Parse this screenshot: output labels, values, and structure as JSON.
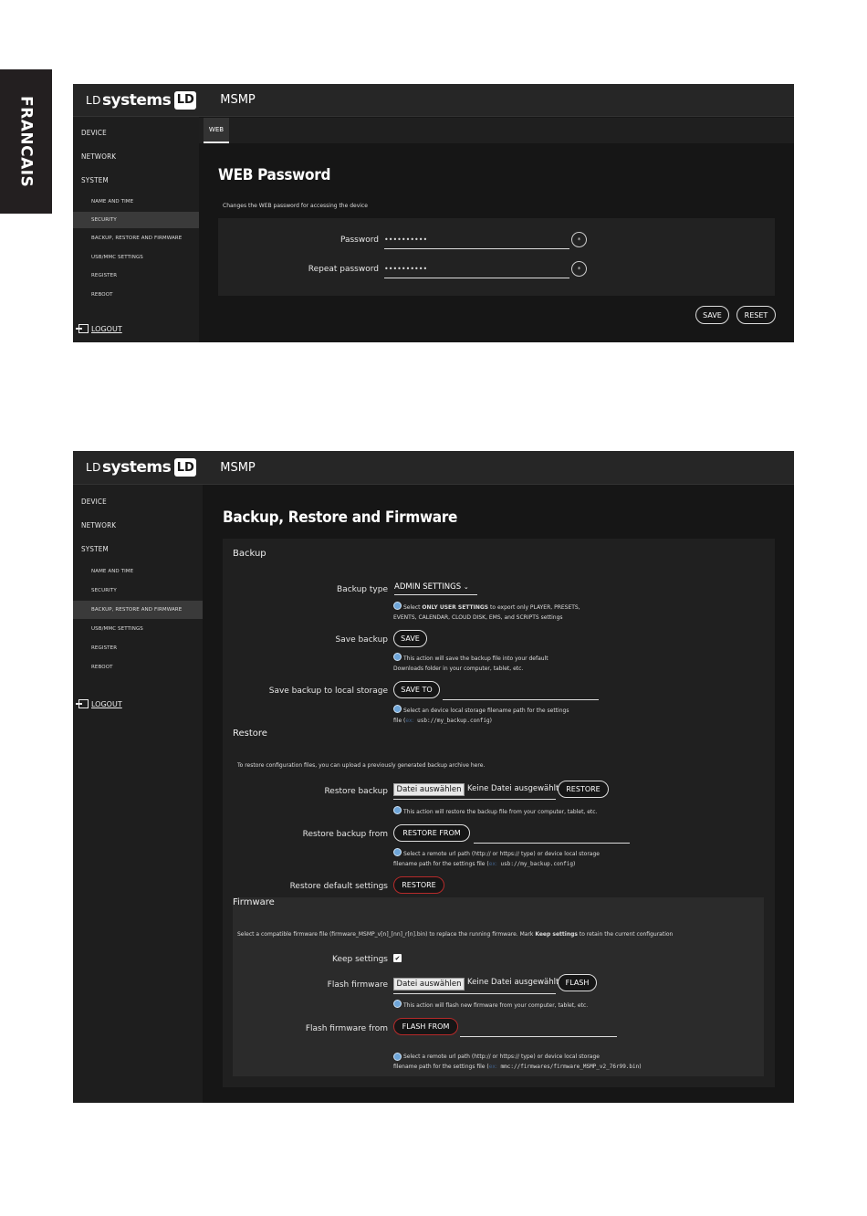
{
  "side_tab": "FRANCAIS",
  "shot1": {
    "logo_ld": "LD",
    "logo_systems": "systems",
    "logo_box": "LD",
    "app_title": "MSMP",
    "nav": {
      "device": "DEVICE",
      "network": "NETWORK",
      "system": "SYSTEM"
    },
    "subnav": [
      "NAME AND TIME",
      "SECURITY",
      "BACKUP, RESTORE AND FIRMWARE",
      "USB/MMC SETTINGS",
      "REGISTER",
      "REBOOT"
    ],
    "logout": "LOGOUT",
    "tab": "WEB",
    "heading": "WEB Password",
    "description": "Changes the WEB password for accessing the device",
    "password_label": "Password",
    "password_value": "••••••••••",
    "repeat_label": "Repeat password",
    "repeat_value": "••••••••••",
    "eye_icon": "*",
    "save": "SAVE",
    "reset": "RESET"
  },
  "shot2": {
    "logo_ld": "LD",
    "logo_systems": "systems",
    "logo_box": "LD",
    "app_title": "MSMP",
    "nav": {
      "device": "DEVICE",
      "network": "NETWORK",
      "system": "SYSTEM"
    },
    "subnav": [
      "NAME AND TIME",
      "SECURITY",
      "BACKUP, RESTORE AND FIRMWARE",
      "USB/MMC SETTINGS",
      "REGISTER",
      "REBOOT"
    ],
    "logout": "LOGOUT",
    "heading": "Backup, Restore and Firmware",
    "backup": {
      "section": "Backup",
      "type_label": "Backup type",
      "type_value": "ADMIN SETTINGS",
      "type_info_1a": "Select ",
      "type_info_1b": "ONLY USER SETTINGS",
      "type_info_1c": " to export only PLAYER, PRESETS,",
      "type_info_2": "EVENTS, CALENDAR, CLOUD DISK, EMS, and SCRIPTS settings",
      "save_label": "Save backup",
      "save_btn": "SAVE",
      "save_info_1": "This action will save the backup file into your default",
      "save_info_2": "Downloads folder in your computer, tablet, etc.",
      "local_label": "Save backup to local storage",
      "local_btn": "SAVE TO",
      "local_info_1": "Select an device local storage filename path for the settings",
      "local_info_2a": "file (",
      "local_info_2b": "ex:",
      "local_info_2c": " usb://my_backup.config",
      "local_info_2d": ")"
    },
    "restore": {
      "section": "Restore",
      "intro": "To restore configuration files, you can upload a previously generated backup archive here.",
      "backup_label": "Restore backup",
      "file_btn": "Datei auswählen",
      "file_none": "Keine Datei ausgewählt",
      "restore_btn": "RESTORE",
      "backup_info": "This action will restore the backup file from your computer, tablet, etc.",
      "from_label": "Restore backup from",
      "from_btn": "RESTORE FROM",
      "from_info_1": "Select a remote url path (http:// or https:// type) or device local storage",
      "from_info_2a": "filename path for the settings file (",
      "from_info_2b": "ex:",
      "from_info_2c": " usb://my_backup.config",
      "from_info_2d": ")",
      "default_label": "Restore default settings",
      "default_btn": "RESTORE"
    },
    "firmware": {
      "section": "Firmware",
      "intro_a": "Select a compatible firmware file (firmware_MSMP_v[n]_[nn]_r[n].bin) to replace the running firmware. Mark ",
      "intro_b": "Keep settings",
      "intro_c": " to retain the current configuration",
      "keep_label": "Keep settings",
      "keep_mark": "✔",
      "flash_label": "Flash firmware",
      "file_btn": "Datei auswählen",
      "file_none": "Keine Datei ausgewählt",
      "flash_btn": "FLASH",
      "flash_info": "This action will flash new firmware from your computer, tablet, etc.",
      "from_label": "Flash firmware from",
      "from_btn": "FLASH FROM",
      "from_info_1": "Select a remote url path (http:// or https:// type) or device local storage",
      "from_info_2a": "filename path for the settings file (",
      "from_info_2b": "ex:",
      "from_info_2c": " mmc://firmwares/firmware_MSMP_v2_76r99.bin",
      "from_info_2d": ")"
    }
  }
}
